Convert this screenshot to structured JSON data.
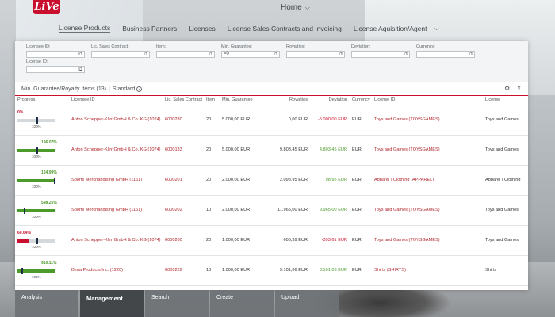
{
  "shell": {
    "logo_text": "LiVe",
    "home_label": "Home",
    "home_chevron": "chevron-down-icon"
  },
  "tabs": [
    {
      "label": "License Products"
    },
    {
      "label": "Business Partners"
    },
    {
      "label": "Licenses"
    },
    {
      "label": "License Sales Contracts and Invoicing"
    },
    {
      "label": "License Aquisition/Agent"
    }
  ],
  "filters": [
    {
      "label": "Licensee ID:",
      "value": ""
    },
    {
      "label": "Lic. Sales Contract:",
      "value": ""
    },
    {
      "label": "Item:",
      "value": ""
    },
    {
      "label": "Min. Guarantee:",
      "value": "=0"
    },
    {
      "label": "Royalties:",
      "value": ""
    },
    {
      "label": "Deviation:",
      "value": ""
    },
    {
      "label": "Currency:",
      "value": ""
    },
    {
      "label": "License ID:",
      "value": ""
    }
  ],
  "toolbar": {
    "title": "Min. Guarantee/Royalty Items (13)",
    "separator": "|",
    "variant": "Standard"
  },
  "columns": {
    "progress": "Progress",
    "licensee": "Licensee ID",
    "contract": "Lic. Sales Contract",
    "item": "Item",
    "min_guarantee": "Min. Guarantee",
    "royalties": "Royalties",
    "deviation": "Deviation",
    "currency": "Currency",
    "license_id": "License ID",
    "license": "License"
  },
  "rows": [
    {
      "pct": "0%",
      "pct_value": 0,
      "pct_color": "#c8102e",
      "base": "100%",
      "licensee": "Anton Schepper-Klirr GmbH & Co. KG (1074)",
      "contract": "6000230",
      "item": "20",
      "mg": "5.000,00",
      "mg_cur": "EUR",
      "roy": "0,00",
      "roy_cur": "EUR",
      "dev": "-5.000,00",
      "dev_cur": "EUR",
      "dev_sign": "neg",
      "currency": "EUR",
      "license_id": "Toys and Games (TOYSGAMES)",
      "license": "Toys and Games"
    },
    {
      "pct": "196.07%",
      "pct_value": 196.07,
      "pct_color": "#4c9a2a",
      "base": "100%",
      "licensee": "Anton Schepper-Klirr GmbH & Co. KG (1074)",
      "contract": "6000133",
      "item": "20",
      "mg": "5.000,00",
      "mg_cur": "EUR",
      "roy": "9.803,45",
      "roy_cur": "EUR",
      "dev": "4.803,45",
      "dev_cur": "EUR",
      "dev_sign": "pos",
      "currency": "EUR",
      "license_id": "Toys and Games (TOYSGAMES)",
      "license": "Toys and Games"
    },
    {
      "pct": "104.99%",
      "pct_value": 104.99,
      "pct_color": "#4c9a2a",
      "base": "100%",
      "licensee": "Sports Merchandising GmbH (1161)",
      "contract": "6000201",
      "item": "20",
      "mg": "2.000,00",
      "mg_cur": "EUR",
      "roy": "2.098,95",
      "roy_cur": "EUR",
      "dev": "98,95",
      "dev_cur": "EUR",
      "dev_sign": "pos",
      "currency": "EUR",
      "license_id": "Apparel / Clothing (APPAREL)",
      "license": "Apparel / Clothing"
    },
    {
      "pct": "598.25%",
      "pct_value": 598.25,
      "pct_color": "#4c9a2a",
      "base": "100%",
      "licensee": "Sports Merchandising GmbH (1161)",
      "contract": "6000202",
      "item": "10",
      "mg": "2.000,00",
      "mg_cur": "EUR",
      "roy": "11.965,00",
      "roy_cur": "EUR",
      "dev": "9.965,00",
      "dev_cur": "EUR",
      "dev_sign": "pos",
      "currency": "EUR",
      "license_id": "Toys and Games (TOYSGAMES)",
      "license": "Toys and Games"
    },
    {
      "pct": "60.64%",
      "pct_value": 60.64,
      "pct_color": "#c8102e",
      "base": "100%",
      "licensee": "Anton Schepper-Klirr GmbH & Co. KG (1074)",
      "contract": "6000200",
      "item": "20",
      "mg": "1.000,00",
      "mg_cur": "EUR",
      "roy": "606,39",
      "roy_cur": "EUR",
      "dev": "-393,61",
      "dev_cur": "EUR",
      "dev_sign": "neg",
      "currency": "EUR",
      "license_id": "Toys and Games (TOYSGAMES)",
      "license": "Toys and Games"
    },
    {
      "pct": "910.11%",
      "pct_value": 910.11,
      "pct_color": "#4c9a2a",
      "base": "100%",
      "licensee": "Dima Products Inc. (1220)",
      "contract": "6000222",
      "item": "10",
      "mg": "1.000,00",
      "mg_cur": "EUR",
      "roy": "9.101,06",
      "roy_cur": "EUR",
      "dev": "8.101,06",
      "dev_cur": "EUR",
      "dev_sign": "pos",
      "currency": "EUR",
      "license_id": "Shirts (SHIRTS)",
      "license": "Shirts"
    }
  ],
  "tiles": [
    {
      "label": "Analysis",
      "style": "light"
    },
    {
      "label": "Management",
      "style": "dark"
    },
    {
      "label": "Search",
      "style": "light"
    },
    {
      "label": "Create",
      "style": "light"
    },
    {
      "label": "Upload",
      "style": "light"
    }
  ]
}
